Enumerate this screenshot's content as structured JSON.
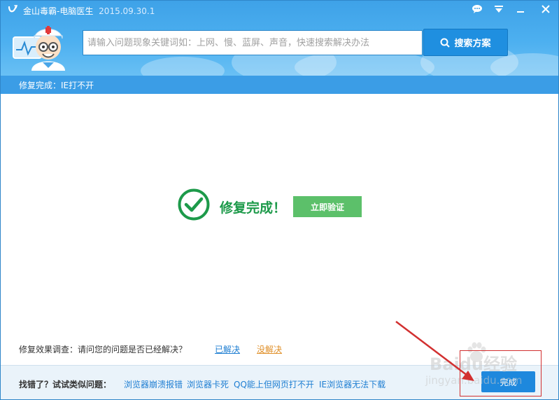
{
  "window": {
    "app_title": "金山毒霸-电脑医生",
    "version": "2015.09.30.1"
  },
  "search": {
    "placeholder": "请输入问题现象关键词如：上网、慢、蓝屏、声音，快速搜索解决办法",
    "button_label": "搜索方案"
  },
  "status": {
    "text": "修复完成：IE打不开"
  },
  "result": {
    "title": "修复完成！",
    "verify_label": "立即验证"
  },
  "survey": {
    "question": "修复效果调查：请问您的问题是否已经解决？",
    "resolved": "已解决",
    "unresolved": "没解决"
  },
  "footer": {
    "label": "找错了？试试类似问题：",
    "links": [
      "浏览器崩溃报错",
      "浏览器卡死",
      "QQ能上但网页打不开",
      "IE浏览器无法下载"
    ],
    "finish_label": "完成"
  },
  "watermark": {
    "brand": "Baidu经验",
    "url": "jingyan.baidu.com"
  },
  "colors": {
    "header_blue": "#3ea2e8",
    "status_blue": "#3b9de6",
    "success_green": "#1d9a4a",
    "verify_green": "#5cc06a",
    "link_blue": "#1e7ed2",
    "unresolved_orange": "#e0902a",
    "annotation_red": "#d23030"
  }
}
